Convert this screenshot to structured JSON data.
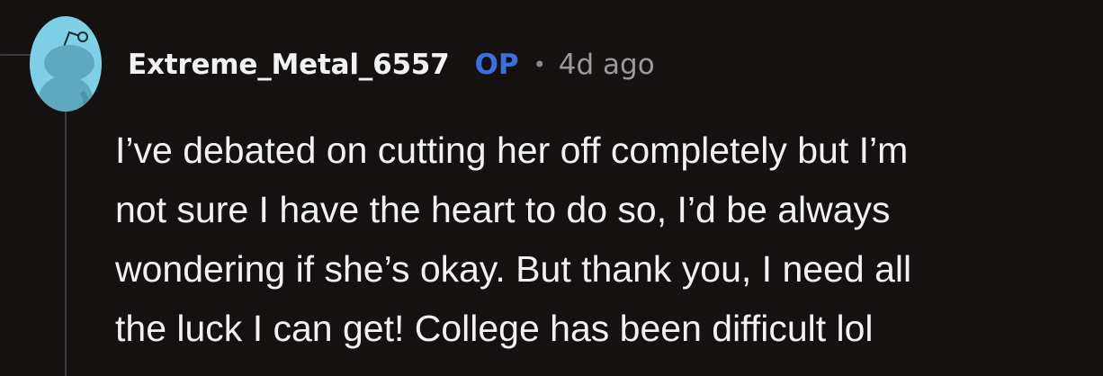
{
  "comment": {
    "author": "Extreme_Metal_6557",
    "badge": "OP",
    "separator": "•",
    "age": "4d ago",
    "body_lines": [
      "I’ve debated on cutting her off completely but I’m",
      "not sure I have the heart to do so, I’d be always",
      "wondering if she’s okay. But thank you, I need all",
      "the luck I can get! College has been difficult lol"
    ]
  },
  "colors": {
    "background": "#141110",
    "avatar_bg": "#7fd0e6",
    "op_badge": "#3b6fe0",
    "text": "#f1f1f1",
    "meta": "#9a9a9a"
  },
  "icons": {
    "avatar": "snoo-avatar-icon"
  }
}
